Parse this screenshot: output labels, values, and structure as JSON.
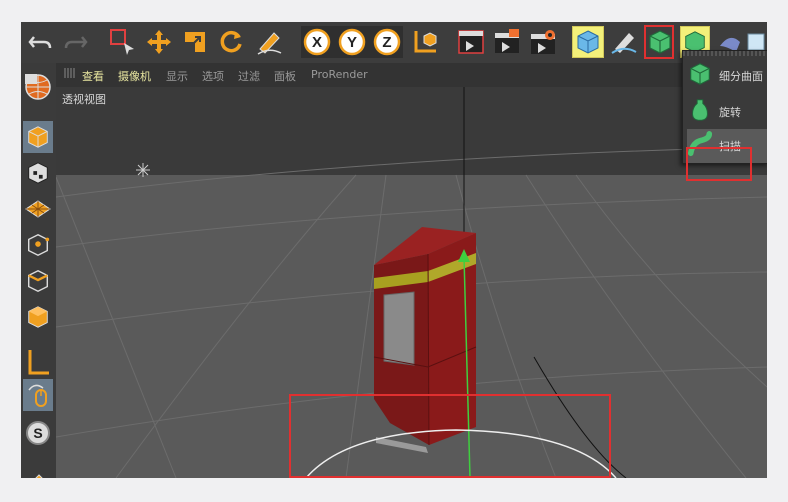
{
  "toolbar": {
    "icons": [
      "undo-icon",
      "redo-icon",
      "live-select-icon",
      "move-icon",
      "scale-icon",
      "rotate-icon",
      "pen-tool-icon",
      "x-axis-lock-icon",
      "y-axis-lock-icon",
      "z-axis-lock-icon",
      "coordinate-system-icon",
      "render-view-icon",
      "render-picture-viewer-icon",
      "render-settings-icon",
      "cube-object-icon",
      "spline-pen-icon",
      "subdivision-surface-icon",
      "extra-icon"
    ],
    "axis_labels": [
      "X",
      "Y",
      "Z"
    ]
  },
  "menu": {
    "items": [
      "查看",
      "摄像机",
      "显示",
      "选项",
      "过滤",
      "面板",
      "ProRender"
    ],
    "active": [
      "查看",
      "摄像机"
    ]
  },
  "viewport": {
    "label": "透视视图"
  },
  "dropdown": {
    "items": [
      {
        "label": "细分曲面",
        "icon": "subdivision-surface-icon"
      },
      {
        "label": "旋转",
        "icon": "lathe-icon"
      },
      {
        "label": "扫描",
        "icon": "sweep-icon"
      }
    ],
    "selected": "扫描"
  },
  "colors": {
    "highlight_outline": "#e03030",
    "model_red": "#8a1a1a",
    "model_stripe": "#a8a020",
    "axis_green": "#3fcf3f",
    "active_menu_text": "#e8e6a0"
  }
}
